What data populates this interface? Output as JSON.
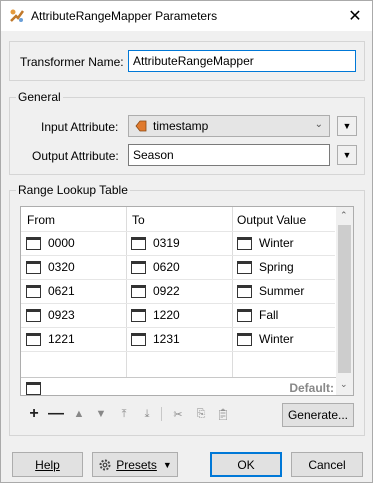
{
  "window": {
    "title": "AttributeRangeMapper Parameters"
  },
  "transformer": {
    "label": "Transformer Name:",
    "value": "AttributeRangeMapper"
  },
  "general": {
    "title": "General",
    "input_label": "Input Attribute:",
    "input_value": "timestamp",
    "output_label": "Output Attribute:",
    "output_value": "Season"
  },
  "table": {
    "title": "Range Lookup Table",
    "headers": [
      "From",
      "To",
      "Output Value"
    ],
    "rows": [
      {
        "from": "0000",
        "to": "0319",
        "value": "Winter"
      },
      {
        "from": "0320",
        "to": "0620",
        "value": "Spring"
      },
      {
        "from": "0621",
        "to": "0922",
        "value": "Summer"
      },
      {
        "from": "0923",
        "to": "1220",
        "value": "Fall"
      },
      {
        "from": "1221",
        "to": "1231",
        "value": "Winter"
      }
    ],
    "default_label": "Default:"
  },
  "toolbar": {
    "generate_label": "Generate...",
    "icons": [
      "add-row-icon",
      "remove-row-icon",
      "move-up-icon",
      "move-down-icon",
      "move-top-icon",
      "move-bottom-icon",
      "cut-icon",
      "copy-icon",
      "paste-icon"
    ]
  },
  "footer": {
    "help": "Help",
    "presets": "Presets",
    "ok": "OK",
    "cancel": "Cancel"
  },
  "colors": {
    "focus": "#0078d7",
    "attr_icon": "#e07a2e"
  }
}
